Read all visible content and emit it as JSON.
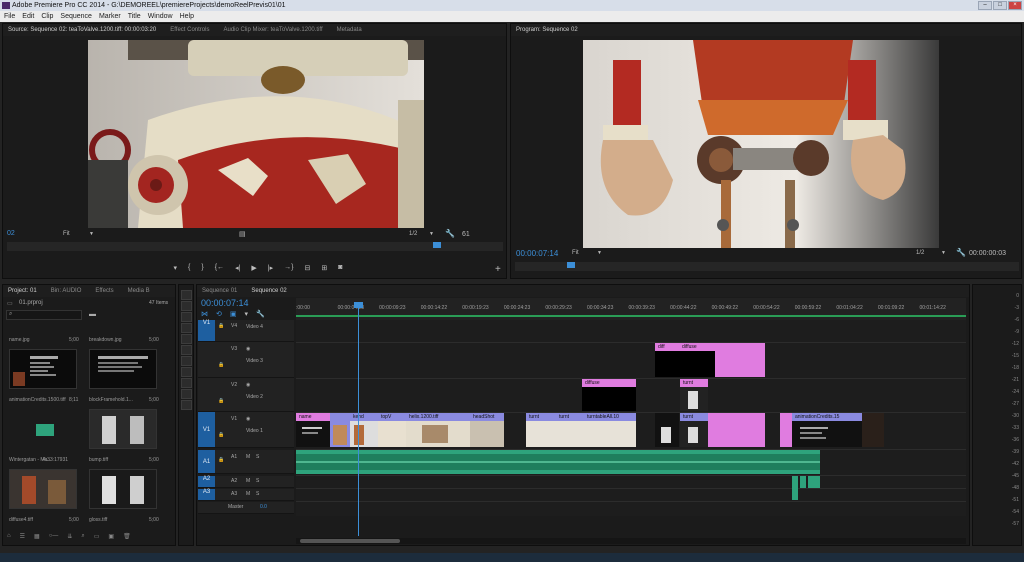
{
  "window": {
    "title": "Adobe Premiere Pro CC 2014 - G:\\DEMOREEL\\premiereProjects\\demoReelPrevis01\\01"
  },
  "menu": [
    "File",
    "Edit",
    "Clip",
    "Sequence",
    "Marker",
    "Title",
    "Window",
    "Help"
  ],
  "source_monitor": {
    "tabs": [
      "Source: Sequence 02: teaToValve.1200.tiff: 00:00:03:20",
      "Effect Controls",
      "Audio Clip Mixer: teaToValve.1200.tiff",
      "Metadata"
    ],
    "timecode_in": "02",
    "fit": "Fit",
    "resolution": "1/2",
    "duration": "61"
  },
  "program_monitor": {
    "tab": "Program: Sequence 02",
    "timecode": "00:00:07:14",
    "fit": "Fit",
    "resolution": "1/2",
    "duration": "00:00:00:03"
  },
  "project": {
    "tabs": [
      "Project: 01",
      "Bin: AUDIO",
      "Effects",
      "Media B"
    ],
    "name": "01.prproj",
    "count": "47 Items",
    "items": [
      {
        "name": "name.jpg",
        "dur": "5;00"
      },
      {
        "name": "breakdown.jpg",
        "dur": "5;00"
      },
      {
        "name": "animationCredits.1500.tiff",
        "dur": "8;11"
      },
      {
        "name": "blockFramehold.1...",
        "dur": "5;00"
      },
      {
        "name": "Wintergatan - Ma...",
        "dur": "4:33:17931"
      },
      {
        "name": "bump.tiff",
        "dur": "5;00"
      },
      {
        "name": "diffuse4.tiff",
        "dur": "5;00"
      },
      {
        "name": "gloss.tiff",
        "dur": "5;00"
      }
    ]
  },
  "timeline": {
    "tabs": [
      "Sequence 01",
      "Sequence 02"
    ],
    "timecode": "00:00:07:14",
    "ruler": [
      ":00:00",
      "00:00:04:23",
      "00:00:09:23",
      "00:00:14:22",
      "00:00:19:23",
      "00:00:24:23",
      "00:00:29:23",
      "00:00:34:23",
      "00:00:39:23",
      "00:00:44:22",
      "00:00:49:22",
      "00:00:54:22",
      "00:00:59:22",
      "00:01:04:22",
      "00:01:09:22",
      "00:01:14:22"
    ],
    "tracks": {
      "v4": {
        "tag": "V1",
        "code": "V4",
        "name": "Video 4"
      },
      "v3": {
        "code": "V3",
        "name": "Video 3"
      },
      "v2": {
        "code": "V2",
        "name": "Video 2"
      },
      "v1": {
        "tag": "V1",
        "code": "V1",
        "name": "Video 1"
      },
      "a1": {
        "tag": "A1",
        "code": "A1"
      },
      "a2": {
        "tag": "A2",
        "code": "A2"
      },
      "a3": {
        "tag": "A3",
        "code": "A3"
      },
      "master": {
        "name": "Master",
        "value": "0.0"
      }
    },
    "clips": {
      "v3_a": "diff",
      "v3_b": "diffuse",
      "v2_a": "diffuse",
      "v2_b": "turnt",
      "v1_name": "name",
      "v1_kend": "kend",
      "v1_topv": "topV",
      "v1_helix": "helix.1200.tiff",
      "v1_headshot": "headShot",
      "v1_turnt": "turnt",
      "v1_turnt2": "turnt",
      "v1_turntable": "turntableAll.10",
      "v1_turnt3": "turnt",
      "v1_credits": "animationCredits.15"
    },
    "audio_meter": [
      "0",
      "-3",
      "-6",
      "-9",
      "-12",
      "-15",
      "-18",
      "-21",
      "-24",
      "-27",
      "-30",
      "-33",
      "-36",
      "-39",
      "-42",
      "-45",
      "-48",
      "-51",
      "-54",
      "-57"
    ]
  },
  "colors": {
    "accent": "#3c8fd8",
    "video_clip": "#8a8ae0",
    "pink_clip": "#e07ce0",
    "audio_clip": "#2ea37c"
  }
}
